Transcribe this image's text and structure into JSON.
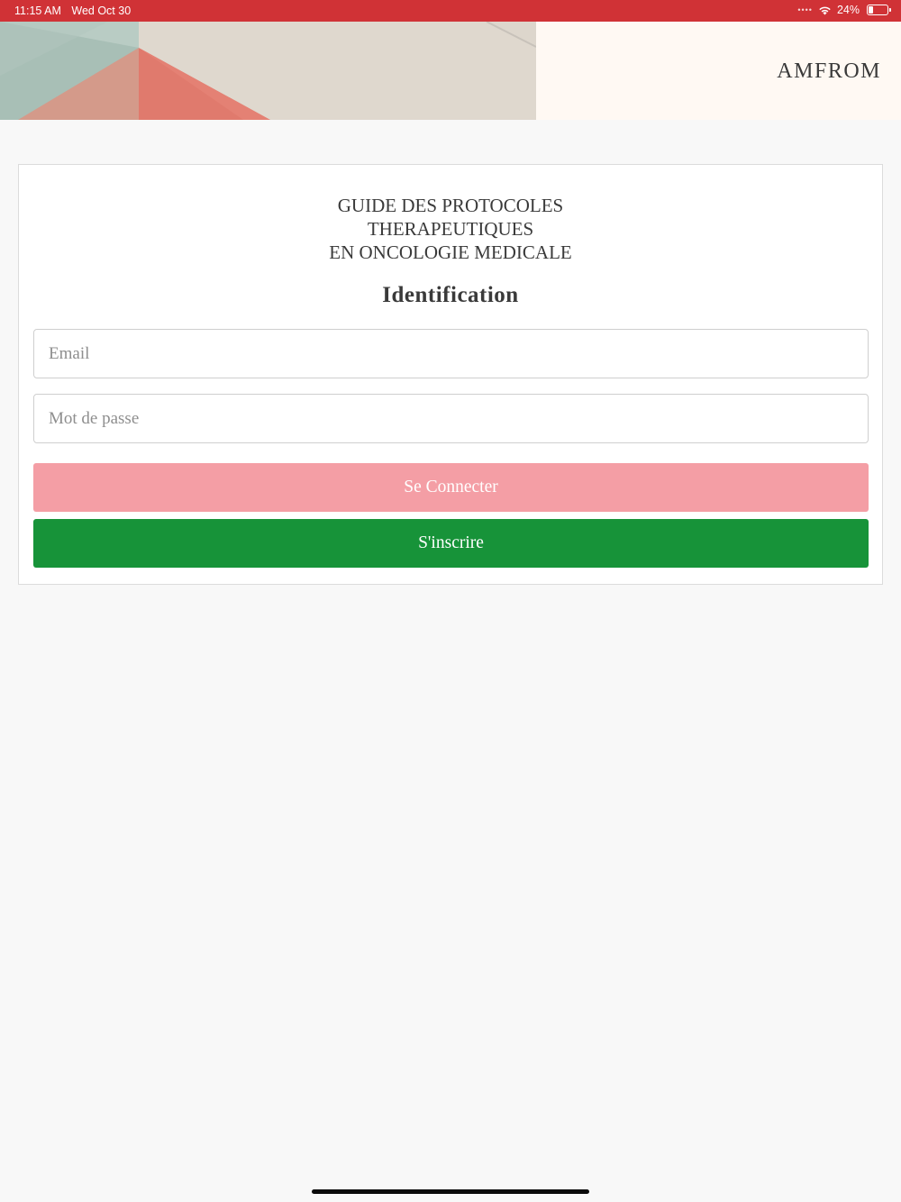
{
  "status_bar": {
    "time": "11:15 AM",
    "date": "Wed Oct 30",
    "battery": "24%",
    "battery_level": 0.24,
    "icons": [
      "cellular-dots-icon",
      "wifi-icon",
      "battery-icon"
    ]
  },
  "header": {
    "brand": "AMFROM"
  },
  "login": {
    "title_lines": [
      "GUIDE DES PROTOCOLES",
      "THERAPEUTIQUES",
      "EN ONCOLOGIE MEDICALE"
    ],
    "heading": "Identification",
    "email_placeholder": "Email",
    "password_placeholder": "Mot de passe",
    "connect_label": "Se Connecter",
    "register_label": "S'inscrire"
  },
  "colors": {
    "status_bar": "#d03236",
    "connect_button": "#f49ea5",
    "register_button": "#179339",
    "page_background": "#f8f8f8"
  }
}
